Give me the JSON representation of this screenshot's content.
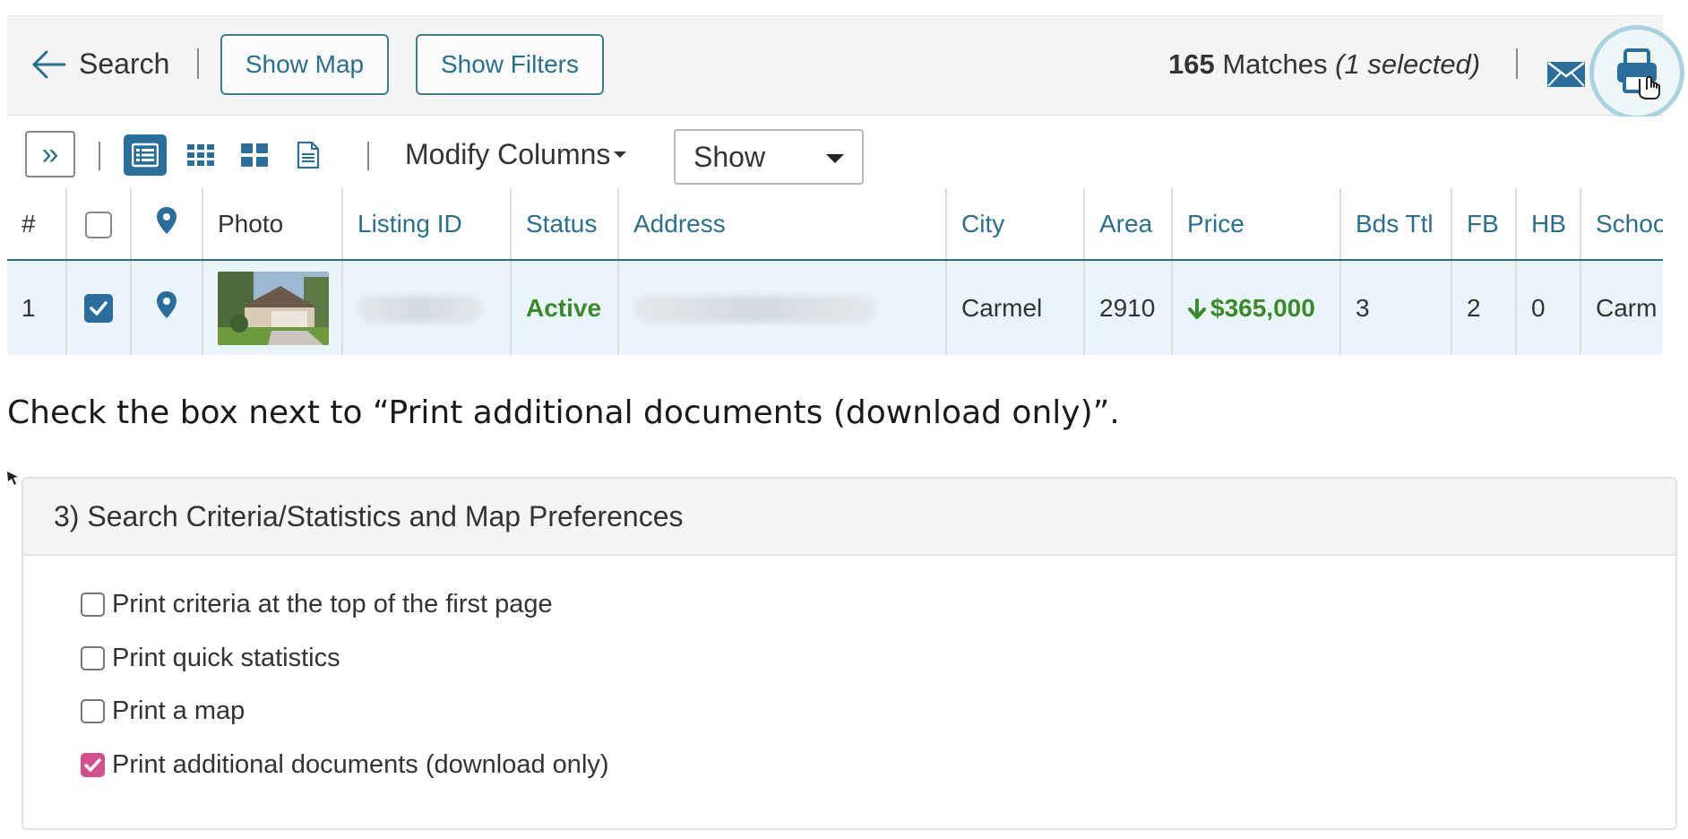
{
  "topbar": {
    "back_label": "Search",
    "show_map": "Show Map",
    "show_filters": "Show Filters",
    "matches_count": "165",
    "matches_label": "Matches",
    "selected_text": "(1 selected)"
  },
  "viewbar": {
    "expand_glyph": "»",
    "modify_columns": "Modify Columns",
    "show_select": "Show"
  },
  "table": {
    "headers": [
      "#",
      "",
      "",
      "Photo",
      "Listing ID",
      "Status",
      "Address",
      "City",
      "Area",
      "Price",
      "Bds Ttl",
      "FB",
      "HB",
      "Schoo"
    ],
    "row": {
      "num": "1",
      "status": "Active",
      "city": "Carmel",
      "area": "2910",
      "price": "$365,000",
      "bds_ttl": "3",
      "fb": "2",
      "hb": "0",
      "school": "Carm"
    }
  },
  "instruction": "Check the box next to “Print additional documents (download only)”.",
  "panel": {
    "title": "3) Search Criteria/Statistics and Map Preferences",
    "options": [
      {
        "label": "Print criteria at the top of the first page",
        "checked": false
      },
      {
        "label": "Print quick statistics",
        "checked": false
      },
      {
        "label": "Print a map",
        "checked": false
      },
      {
        "label": "Print additional documents (download only)",
        "checked": true
      }
    ]
  },
  "colors": {
    "accent": "#2a6f8c",
    "active_green": "#3b8a2a",
    "checkbox_pink": "#d4508d",
    "print_highlight": "#a9d3e0"
  }
}
